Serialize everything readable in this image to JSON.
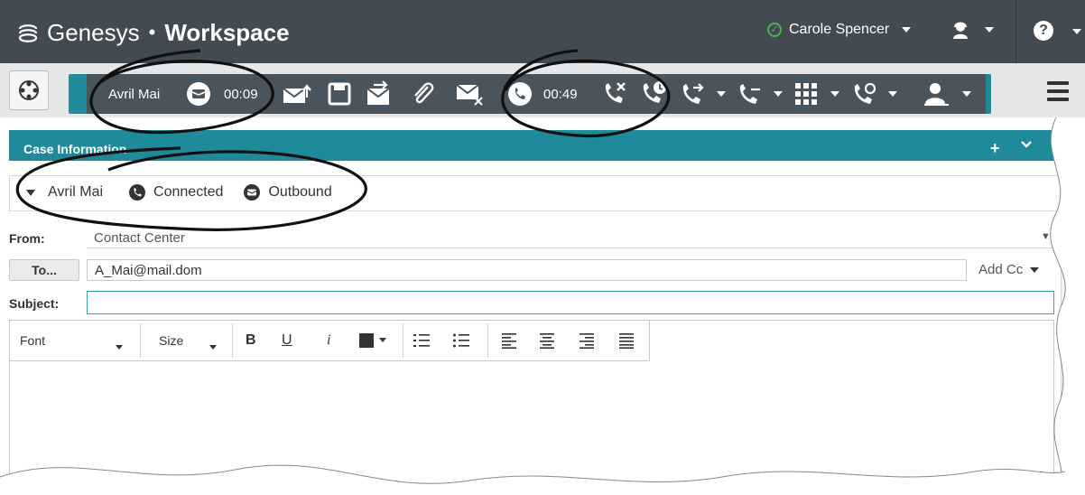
{
  "header": {
    "brand_name": "Genesys",
    "brand_separator": "•",
    "product_name": "Workspace",
    "user_name": "Carole Spencer",
    "help_symbol": "?"
  },
  "interaction_bar": {
    "contact_name": "Avril Mai",
    "email_timer": "00:09",
    "call_timer": "00:49"
  },
  "case": {
    "title": "Case Information",
    "add_symbol": "+",
    "party_name": "Avril Mai",
    "call_state": "Connected",
    "direction": "Outbound"
  },
  "form": {
    "from_label": "From:",
    "from_value": "Contact Center",
    "to_button": "To...",
    "to_value": "A_Mai@mail.dom",
    "add_cc": "Add Cc",
    "subject_label": "Subject:",
    "subject_value": ""
  },
  "editor_toolbar": {
    "font_label": "Font",
    "size_label": "Size",
    "bold": "B",
    "underline": "U",
    "italic": "i"
  },
  "colors": {
    "header_bg": "#434b52",
    "accent_teal": "#1f8b9a",
    "status_green": "#4caf50",
    "interaction_bg": "#4a545c"
  }
}
